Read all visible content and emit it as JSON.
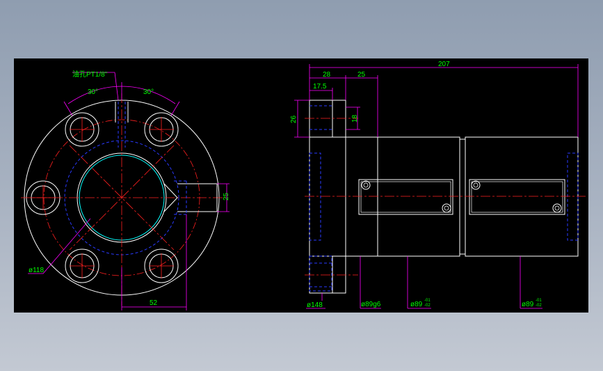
{
  "drawing": {
    "front_view": {
      "tap_note": "油孔PT1/8\"",
      "angle_left": "30°",
      "angle_right": "30°",
      "dim_bolt_circle": "25",
      "dim_horizontal": "52",
      "dim_diameter": "ø118"
    },
    "side_view": {
      "dim_total_length": "207",
      "dim_flange_length": "28",
      "dim_body_offset": "25",
      "dim_flange_inner": "17.5",
      "dim_height_26": "26",
      "dim_height_18": "18",
      "dim_flange_dia": "ø148",
      "dim_body_dia": "ø89g6",
      "dim_body_dia_2": "ø89",
      "tol_2_upper": "-01",
      "tol_2_lower": "-02",
      "dim_body_dia_3": "ø89",
      "tol_3_upper": "-01",
      "tol_3_lower": "-02"
    }
  },
  "colors": {
    "outline": "#ffffff",
    "center": "#ff2020",
    "dimension": "#ff00ff",
    "text": "#00ff00",
    "hidden": "#2a3aff",
    "cyan": "#00ffff"
  }
}
